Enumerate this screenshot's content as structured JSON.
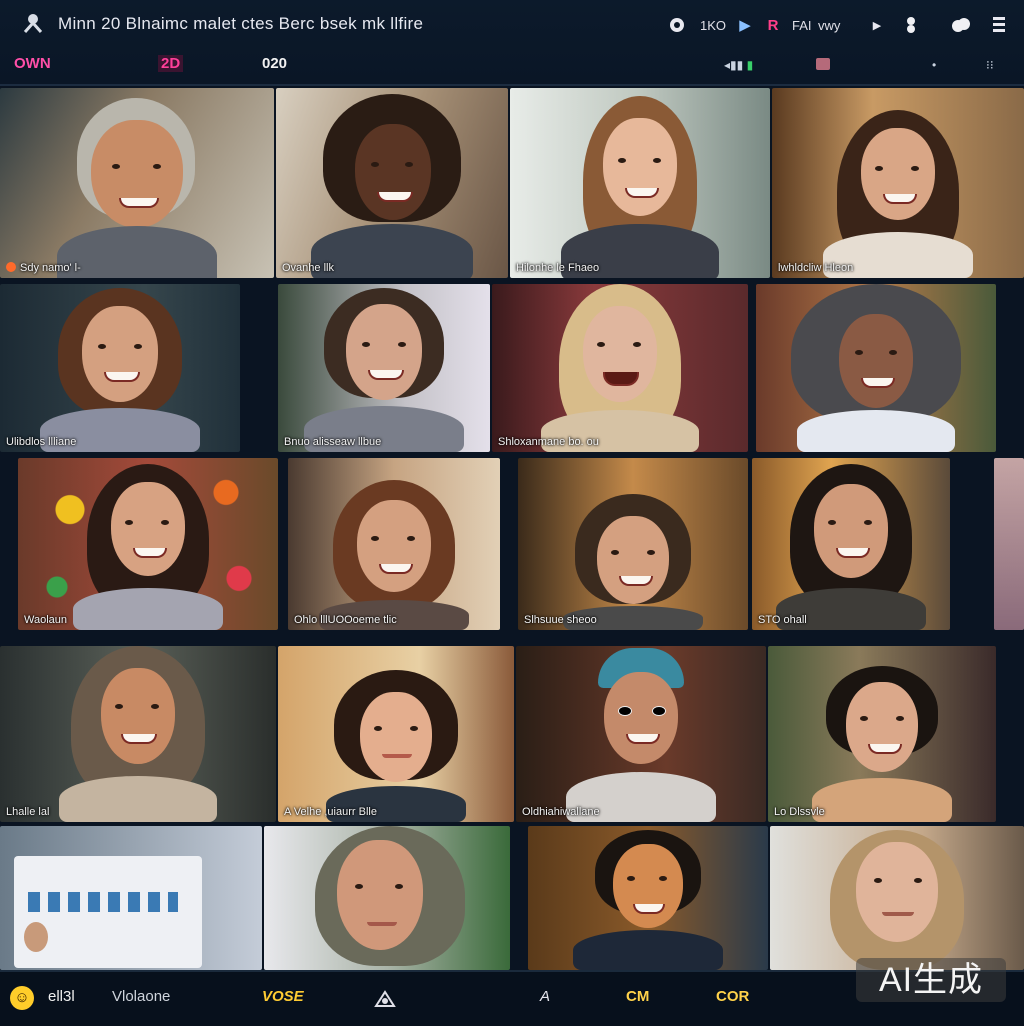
{
  "header": {
    "title": "Minn 20 Blnaimc malet ctes Berc bsek mk llfire",
    "stats": [
      "OWN",
      "2D",
      "020"
    ],
    "icons": [
      "chat-icon",
      "participants-icon",
      "play-icon",
      "record-icon",
      "grid-view-icon",
      "share-icon",
      "reaction-icon",
      "cloud-icon",
      "menu-icon"
    ],
    "labels": {
      "participants": "1KO",
      "grid": "FAI",
      "view": "vwy"
    }
  },
  "tiles": [
    {
      "name": "Sdy namo' l-"
    },
    {
      "name": "Ovanhe llk"
    },
    {
      "name": "Hilonhe le Fhaeo"
    },
    {
      "name": "lwhldcliw Hleon"
    },
    {
      "name": "Ulibdlos llliane"
    },
    {
      "name": "Bnuo alisseaw llbue"
    },
    {
      "name": "Shloxanmane bo. ou"
    },
    {
      "name": ""
    },
    {
      "name": "Waolaun"
    },
    {
      "name": "Ohlo lllUOOoeme tlic"
    },
    {
      "name": "Slhsuue sheoo"
    },
    {
      "name": "STO ohall"
    },
    {
      "name": "Lhalle lal"
    },
    {
      "name": "A Velhe ,uiaurr Blle"
    },
    {
      "name": "Oldhiahiwallane"
    },
    {
      "name": "Lo Dlssvle"
    },
    {
      "name": ""
    },
    {
      "name": ""
    },
    {
      "name": ""
    },
    {
      "name": ""
    }
  ],
  "footer": {
    "items": [
      "ell3l",
      "Vlolaone",
      "VOSE",
      "A",
      "CM",
      "COR"
    ],
    "watermark": "AI生成"
  },
  "colors": {
    "accent": "#ff4fa8",
    "background": "#0a1422",
    "bar": "#07101c"
  }
}
